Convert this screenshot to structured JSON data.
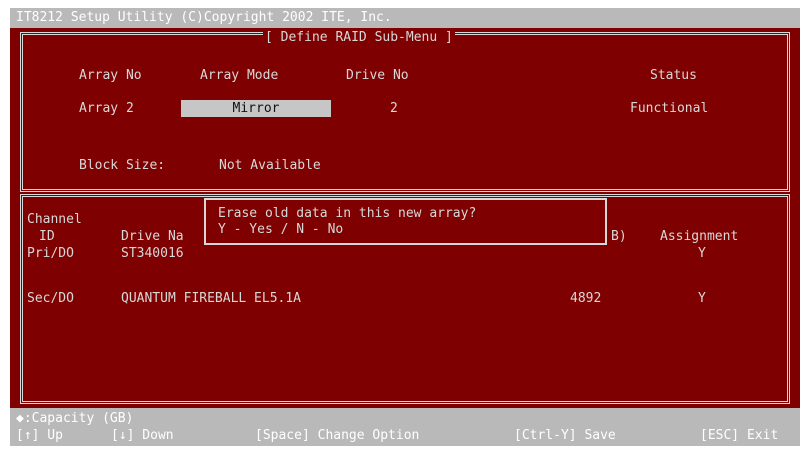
{
  "header": {
    "title": "IT8212 Setup Utility (C)Copyright 2002 ITE, Inc."
  },
  "define_menu": {
    "title": "[ Define RAID Sub-Menu ]",
    "columns": {
      "array_no": "Array No",
      "array_mode": "Array Mode",
      "drive_no": "Drive No",
      "status": "Status"
    },
    "row": {
      "array_no": "Array 2",
      "array_mode": "Mirror",
      "drive_no": "2",
      "status": "Functional"
    },
    "block_size_label": "Block Size:",
    "block_size_value": "Not Available"
  },
  "drive_table": {
    "headers": {
      "channel": "Channel",
      "id": "ID",
      "drive_name": "Drive Na",
      "capacity_partial": "B)",
      "assignment": "Assignment"
    },
    "rows": [
      {
        "channel": "Pri/DO",
        "drive": "ST340016",
        "capacity": "",
        "assignment": "Y"
      },
      {
        "channel": "Sec/DO",
        "drive": "QUANTUM FIREBALL EL5.1A",
        "capacity": "4892",
        "assignment": "Y"
      }
    ]
  },
  "dialog": {
    "line1": "Erase old data in this new array?",
    "line2": "Y - Yes / N - No"
  },
  "footer": {
    "capacity_legend": ":Capacity (GB)",
    "capacity_icon": "diamond-icon",
    "keys": {
      "up": "[↑] Up",
      "down": "[↓] Down",
      "space": "[Space] Change Option",
      "save": "[Ctrl-Y] Save",
      "exit": "[ESC] Exit"
    }
  },
  "colors": {
    "background": "#7e0000",
    "text": "#d8d8d8",
    "bar": "#b9b9b9",
    "highlight": "#c6c6c6"
  }
}
